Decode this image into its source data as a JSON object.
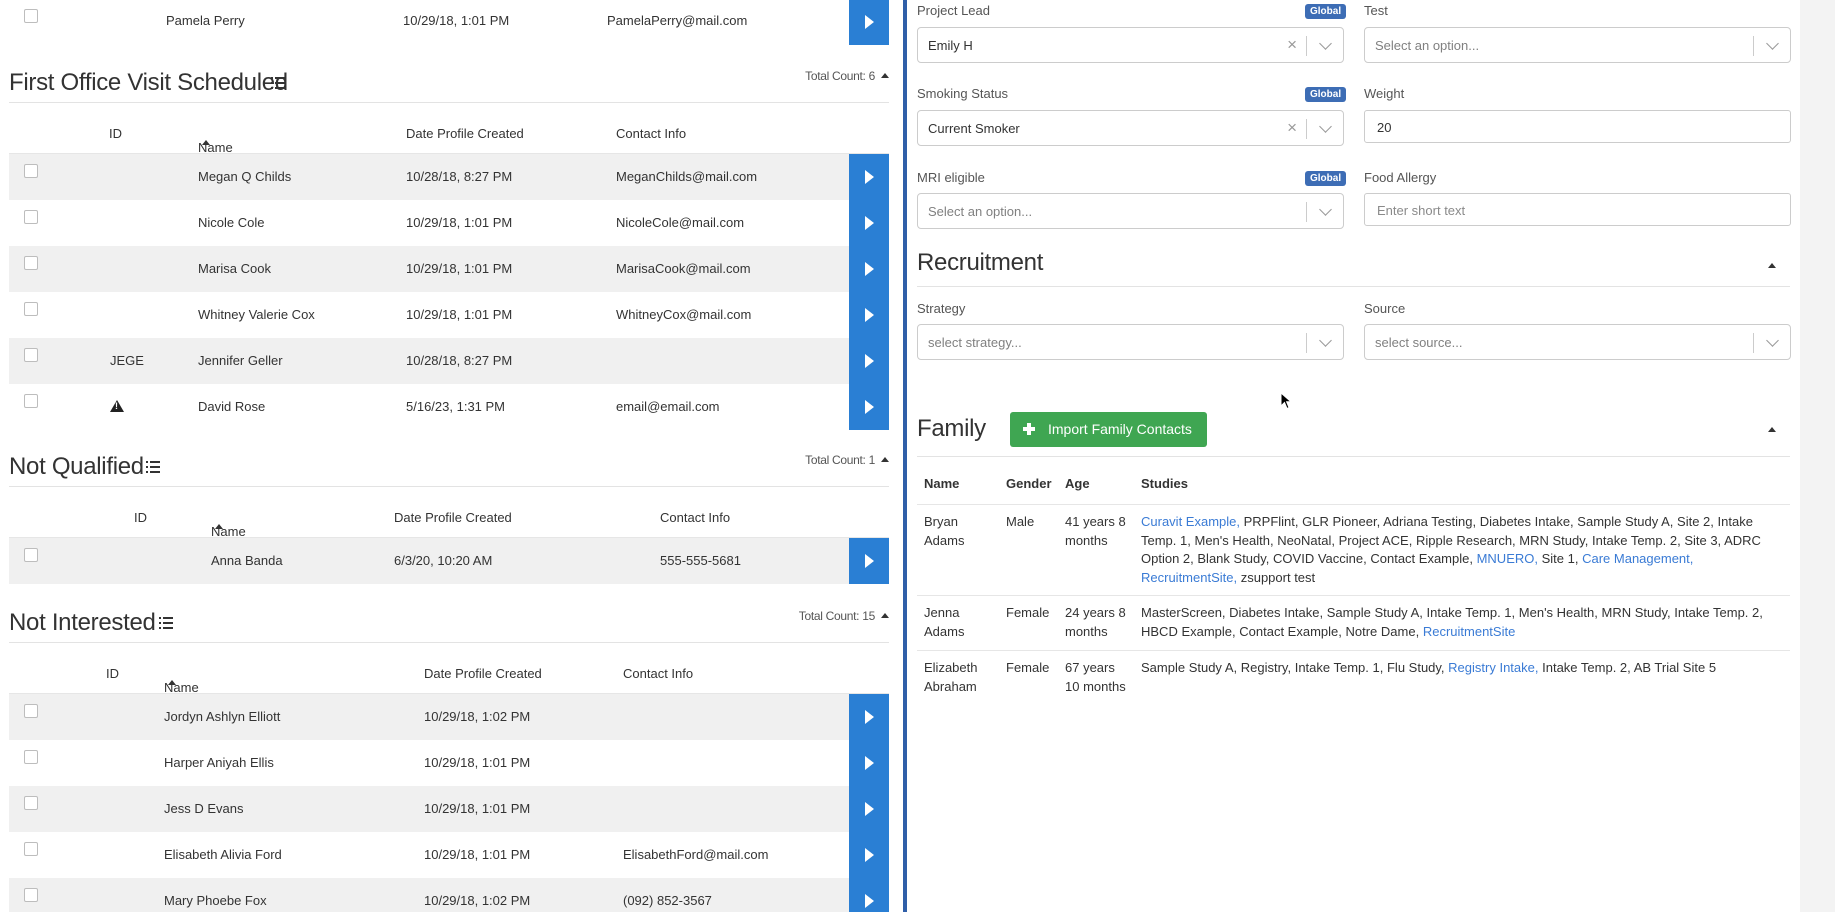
{
  "top_partial_row": {
    "name": "Pamela Perry",
    "date": "10/29/18, 1:01 PM",
    "contact": "PamelaPerry@mail.com"
  },
  "sections": [
    {
      "title": "First Office Visit Scheduled",
      "total": "Total Count: 6",
      "columns": {
        "id": "ID",
        "name": "Name",
        "date": "Date Profile Created",
        "contact": "Contact Info"
      },
      "rows": [
        {
          "id": "",
          "name": "Megan Q Childs",
          "date": "10/28/18, 8:27 PM",
          "contact": "MeganChilds@mail.com"
        },
        {
          "id": "",
          "name": "Nicole Cole",
          "date": "10/29/18, 1:01 PM",
          "contact": "NicoleCole@mail.com"
        },
        {
          "id": "",
          "name": "Marisa Cook",
          "date": "10/29/18, 1:01 PM",
          "contact": "MarisaCook@mail.com"
        },
        {
          "id": "",
          "name": "Whitney Valerie Cox",
          "date": "10/29/18, 1:01 PM",
          "contact": "WhitneyCox@mail.com"
        },
        {
          "id": "JEGE",
          "name": "Jennifer Geller",
          "date": "10/28/18, 8:27 PM",
          "contact": ""
        },
        {
          "id": "warning-icon",
          "name": "David Rose",
          "date": "5/16/23, 1:31 PM",
          "contact": "email@email.com"
        }
      ]
    },
    {
      "title": "Not Qualified",
      "total": "Total Count: 1",
      "columns": {
        "id": "ID",
        "name": "Name",
        "date": "Date Profile Created",
        "contact": "Contact Info"
      },
      "rows": [
        {
          "id": "",
          "name": "Anna Banda",
          "date": "6/3/20, 10:20 AM",
          "contact": "555-555-5681"
        }
      ]
    },
    {
      "title": "Not Interested",
      "total": "Total Count: 15",
      "columns": {
        "id": "ID",
        "name": "Name",
        "date": "Date Profile Created",
        "contact": "Contact Info"
      },
      "rows": [
        {
          "id": "",
          "name": "Jordyn Ashlyn Elliott",
          "date": "10/29/18, 1:02 PM",
          "contact": ""
        },
        {
          "id": "",
          "name": "Harper Aniyah Ellis",
          "date": "10/29/18, 1:01 PM",
          "contact": ""
        },
        {
          "id": "",
          "name": "Jess D Evans",
          "date": "10/29/18, 1:01 PM",
          "contact": ""
        },
        {
          "id": "",
          "name": "Elisabeth Alivia Ford",
          "date": "10/29/18, 1:01 PM",
          "contact": "ElisabethFord@mail.com"
        },
        {
          "id": "",
          "name": "Mary Phoebe Fox",
          "date": "10/29/18, 1:02 PM",
          "contact": "(092) 852-3567"
        }
      ]
    }
  ],
  "form": {
    "global_badge": "Global",
    "project_lead": {
      "label": "Project Lead",
      "value": "Emily H"
    },
    "test": {
      "label": "Test",
      "placeholder": "Select an option..."
    },
    "smoking_status": {
      "label": "Smoking Status",
      "value": "Current Smoker"
    },
    "weight": {
      "label": "Weight",
      "value": "20"
    },
    "mri_eligible": {
      "label": "MRI eligible",
      "placeholder": "Select an option..."
    },
    "food_allergy": {
      "label": "Food Allergy",
      "placeholder": "Enter short text"
    },
    "clear_glyph": "×"
  },
  "recruitment": {
    "title": "Recruitment",
    "strategy": {
      "label": "Strategy",
      "placeholder": "select strategy..."
    },
    "source": {
      "label": "Source",
      "placeholder": "select source..."
    }
  },
  "family": {
    "title": "Family",
    "import_button": "Import Family Contacts",
    "columns": {
      "name": "Name",
      "gender": "Gender",
      "age": "Age",
      "studies": "Studies"
    },
    "members": [
      {
        "name": "Bryan Adams",
        "gender": "Male",
        "age": "41 years 8 months",
        "studies": [
          {
            "text": "Curavit Example,",
            "link": true
          },
          {
            "text": "PRPFlint,",
            "link": false
          },
          {
            "text": "GLR Pioneer,",
            "link": false
          },
          {
            "text": "Adriana Testing,",
            "link": false
          },
          {
            "text": "Diabetes Intake,",
            "link": false
          },
          {
            "text": "Sample Study A,",
            "link": false
          },
          {
            "text": "Site 2,",
            "link": false
          },
          {
            "text": "Intake Temp. 1,",
            "link": false
          },
          {
            "text": "Men's Health,",
            "link": false
          },
          {
            "text": "NeoNatal,",
            "link": false
          },
          {
            "text": "Project ACE,",
            "link": false
          },
          {
            "text": "Ripple Research,",
            "link": false
          },
          {
            "text": "MRN Study,",
            "link": false
          },
          {
            "text": "Intake Temp. 2,",
            "link": false
          },
          {
            "text": "Site 3,",
            "link": false
          },
          {
            "text": "ADRC Option 2,",
            "link": false
          },
          {
            "text": "Blank Study,",
            "link": false
          },
          {
            "text": "COVID Vaccine,",
            "link": false
          },
          {
            "text": "Contact Example,",
            "link": false
          },
          {
            "text": "MNUERO,",
            "link": true
          },
          {
            "text": "Site 1,",
            "link": false
          },
          {
            "text": "Care Management,",
            "link": true
          },
          {
            "text": "RecruitmentSite,",
            "link": true
          },
          {
            "text": "zsupport test",
            "link": false
          }
        ]
      },
      {
        "name": "Jenna Adams",
        "gender": "Female",
        "age": "24 years 8 months",
        "studies": [
          {
            "text": "MasterScreen,",
            "link": false
          },
          {
            "text": "Diabetes Intake,",
            "link": false
          },
          {
            "text": "Sample Study A,",
            "link": false
          },
          {
            "text": "Intake Temp. 1,",
            "link": false
          },
          {
            "text": "Men's Health,",
            "link": false
          },
          {
            "text": "MRN Study,",
            "link": false
          },
          {
            "text": "Intake Temp. 2,",
            "link": false
          },
          {
            "text": "HBCD Example,",
            "link": false
          },
          {
            "text": "Contact Example,",
            "link": false
          },
          {
            "text": "Notre Dame,",
            "link": false
          },
          {
            "text": "RecruitmentSite",
            "link": true
          }
        ]
      },
      {
        "name": "Elizabeth Abraham",
        "gender": "Female",
        "age": "67 years 10 months",
        "studies": [
          {
            "text": "Sample Study A,",
            "link": false
          },
          {
            "text": "Registry,",
            "link": false
          },
          {
            "text": "Intake Temp. 1,",
            "link": false
          },
          {
            "text": "Flu Study,",
            "link": false
          },
          {
            "text": "Registry Intake,",
            "link": true
          },
          {
            "text": "Intake Temp. 2,",
            "link": false
          },
          {
            "text": "AB Trial Site 5",
            "link": false
          }
        ]
      }
    ]
  },
  "colors": {
    "primary_blue": "#2a7fd4",
    "panel_divider": "#2f5fa8",
    "badge_blue": "#3d6db5",
    "import_green": "#3fa652",
    "link_blue": "#3a7bd5"
  }
}
